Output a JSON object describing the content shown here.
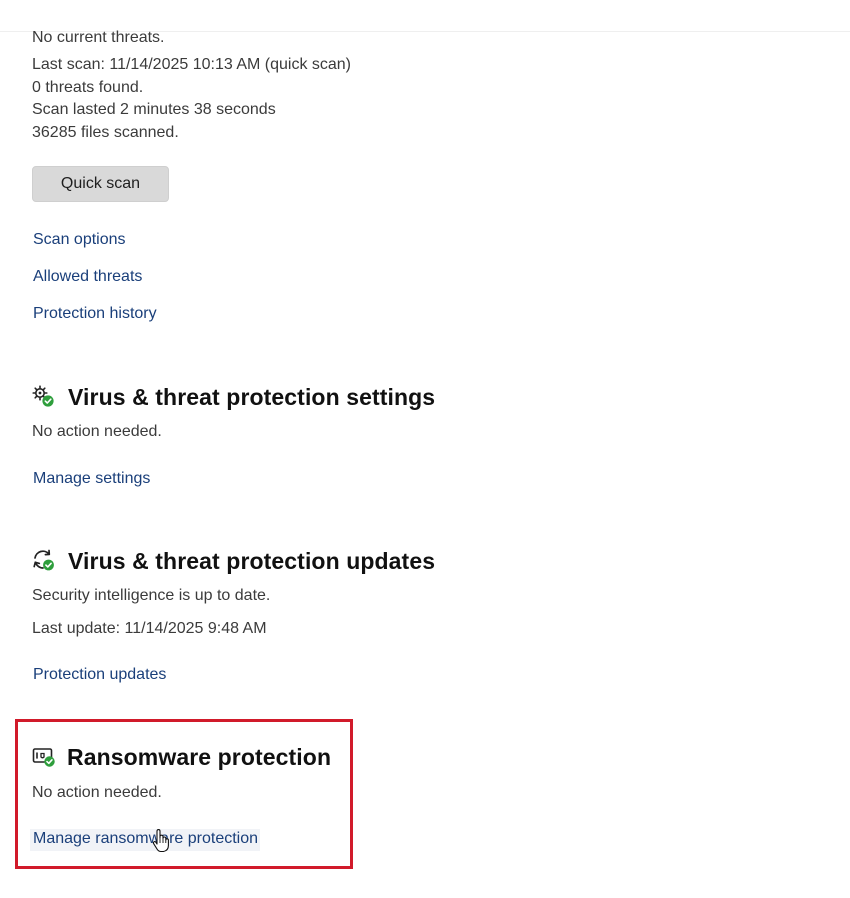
{
  "scan_summary": {
    "status": "No current threats.",
    "last_scan": "Last scan: 11/14/2025 10:13 AM (quick scan)",
    "threats_found": "0 threats found.",
    "duration": "Scan lasted 2 minutes 38 seconds",
    "files_scanned": "36285 files scanned.",
    "quick_scan_label": "Quick scan",
    "links": {
      "scan_options": "Scan options",
      "allowed_threats": "Allowed threats",
      "protection_history": "Protection history"
    }
  },
  "settings_section": {
    "icon": "gear-check-icon",
    "title": "Virus & threat protection settings",
    "status": "No action needed.",
    "link": "Manage settings"
  },
  "updates_section": {
    "icon": "refresh-check-icon",
    "title": "Virus & threat protection updates",
    "status": "Security intelligence is up to date.",
    "last_update": "Last update: 11/14/2025 9:48 AM",
    "link": "Protection updates"
  },
  "ransomware_section": {
    "icon": "folder-shield-check-icon",
    "title": "Ransomware protection",
    "status": "No action needed.",
    "link": "Manage ransomware protection",
    "highlight_color": "#d11a2a"
  },
  "colors": {
    "link": "#1a3f7a",
    "status_ok": "#2e9e3c",
    "text": "#3b3b3b"
  }
}
